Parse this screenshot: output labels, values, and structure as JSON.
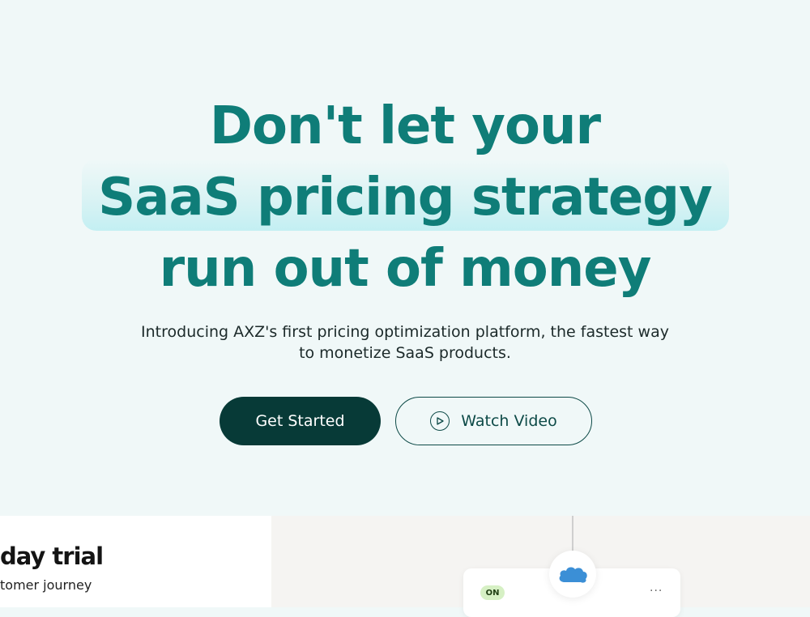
{
  "hero": {
    "headline_line1": "Don't let your",
    "headline_line2": "SaaS pricing strategy",
    "headline_line3": "run out of money",
    "subtitle_line1": "Introducing AXZ's first pricing optimization platform, the fastest way",
    "subtitle_line2": "to monetize SaaS products.",
    "primary_button": "Get Started",
    "secondary_button": "Watch Video"
  },
  "preview": {
    "trial_title": "day trial",
    "trial_subtitle": "tomer journey",
    "status_badge": "ON",
    "more_menu": "···"
  },
  "colors": {
    "background": "#f0f8f8",
    "headline": "#0f7d78",
    "primary_button": "#073a37",
    "highlight": "#c4eef0",
    "badge": "#d6f0c4",
    "cloud": "#3b8fd6"
  },
  "icons": {
    "play": "play-circle-icon",
    "cloud": "cloud-icon",
    "more": "more-horizontal-icon"
  }
}
